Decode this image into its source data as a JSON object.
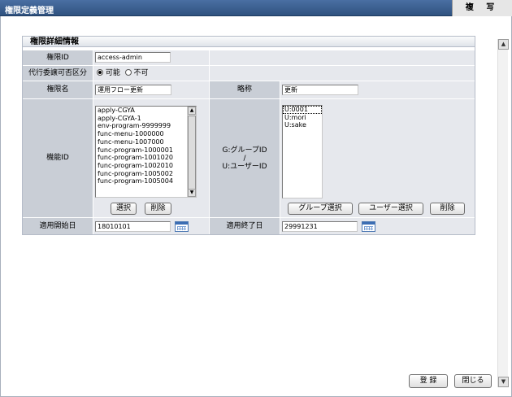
{
  "header": {
    "title": "権限定義管理",
    "copy_label": "複 写"
  },
  "panel": {
    "title": "権限詳細情報",
    "fields": {
      "authority_id": {
        "label": "権限ID",
        "value": "access-admin"
      },
      "delegation": {
        "label": "代行委譲可否区分",
        "options": [
          "可能",
          "不可"
        ],
        "selected": "可能"
      },
      "authority_name": {
        "label": "権限名",
        "value": "運用フロー更新"
      },
      "abbreviation": {
        "label": "略称",
        "value": "更新"
      },
      "function_id": {
        "label": "機能ID",
        "items": [
          "apply-CGYA",
          "apply-CGYA-1",
          "env-program-9999999",
          "func-menu-1000000",
          "func-menu-1007000",
          "func-program-1000001",
          "func-program-1001020",
          "func-program-1002010",
          "func-program-1005002",
          "func-program-1005004"
        ],
        "select_label": "選択",
        "delete_label": "削除"
      },
      "group_user_id": {
        "label_line1": "G:グループID",
        "label_line2": "/",
        "label_line3": "U:ユーザーID",
        "items": [
          "U:0001",
          "U:mori",
          "U:sake"
        ],
        "group_select_label": "グループ選択",
        "user_select_label": "ユーザー選択",
        "delete_label": "削除"
      },
      "start_date": {
        "label": "適用開始日",
        "value": "18010101"
      },
      "end_date": {
        "label": "適用終了日",
        "value": "29991231"
      }
    }
  },
  "footer": {
    "register_label": "登 録",
    "close_label": "閉じる"
  },
  "icons": {
    "calendar": "calendar-icon"
  },
  "colors": {
    "titlebar": "#2f527f",
    "label_bg": "#c9ced6",
    "value_bg": "#e6e8ed",
    "calendar_accent": "#3b6db3"
  }
}
